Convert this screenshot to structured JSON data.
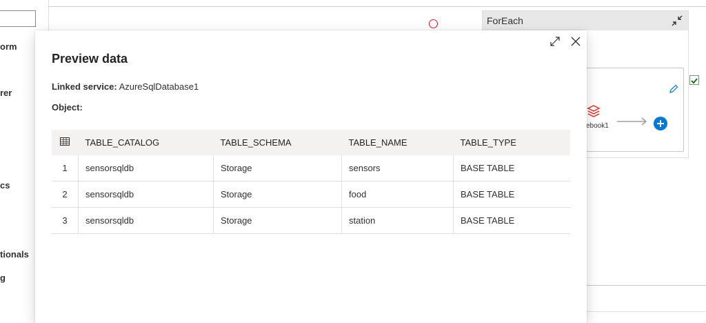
{
  "sidebar": {
    "items": [
      {
        "label": "orm"
      },
      {
        "label": "rer"
      },
      {
        "label": "cs"
      },
      {
        "label": "tionals"
      },
      {
        "label": "g"
      }
    ]
  },
  "canvas": {
    "foreach_title": "ForEach",
    "activity_label": "ebook1"
  },
  "modal": {
    "title": "Preview data",
    "linked_service_label": "Linked service:",
    "linked_service_value": "AzureSqlDatabase1",
    "object_label": "Object:",
    "object_value": "",
    "columns": [
      "TABLE_CATALOG",
      "TABLE_SCHEMA",
      "TABLE_NAME",
      "TABLE_TYPE"
    ],
    "rows": [
      {
        "index": "1",
        "cells": [
          "sensorsqldb",
          "Storage",
          "sensors",
          "BASE TABLE"
        ]
      },
      {
        "index": "2",
        "cells": [
          "sensorsqldb",
          "Storage",
          "food",
          "BASE TABLE"
        ]
      },
      {
        "index": "3",
        "cells": [
          "sensorsqldb",
          "Storage",
          "station",
          "BASE TABLE"
        ]
      }
    ]
  },
  "colors": {
    "accent": "#0078d4",
    "notebook_icon": "#e0423a",
    "checkbox": "#107c10"
  },
  "icons": [
    "expand-icon",
    "close-icon",
    "collapse-icon",
    "table-icon",
    "edit-icon",
    "add-icon",
    "notebook-icon",
    "checkmark-icon"
  ]
}
